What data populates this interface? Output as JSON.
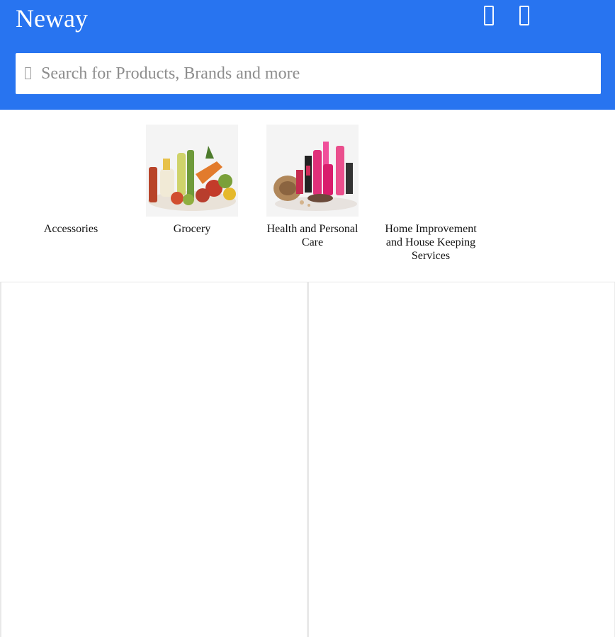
{
  "header": {
    "brand": "Neway",
    "background_color": "#2874f0",
    "icons": [
      "action-icon",
      "action-icon"
    ]
  },
  "search": {
    "placeholder": "Search for Products, Brands and more",
    "value": "",
    "icon": "search-icon"
  },
  "categories": [
    {
      "label": "Accessories",
      "image": "none"
    },
    {
      "label": "Grocery",
      "image": "grocery-image"
    },
    {
      "label": "Health and Personal Care",
      "image": "health-care-image"
    },
    {
      "label": "Home Improvement and House Keeping Services",
      "image": "none"
    }
  ]
}
